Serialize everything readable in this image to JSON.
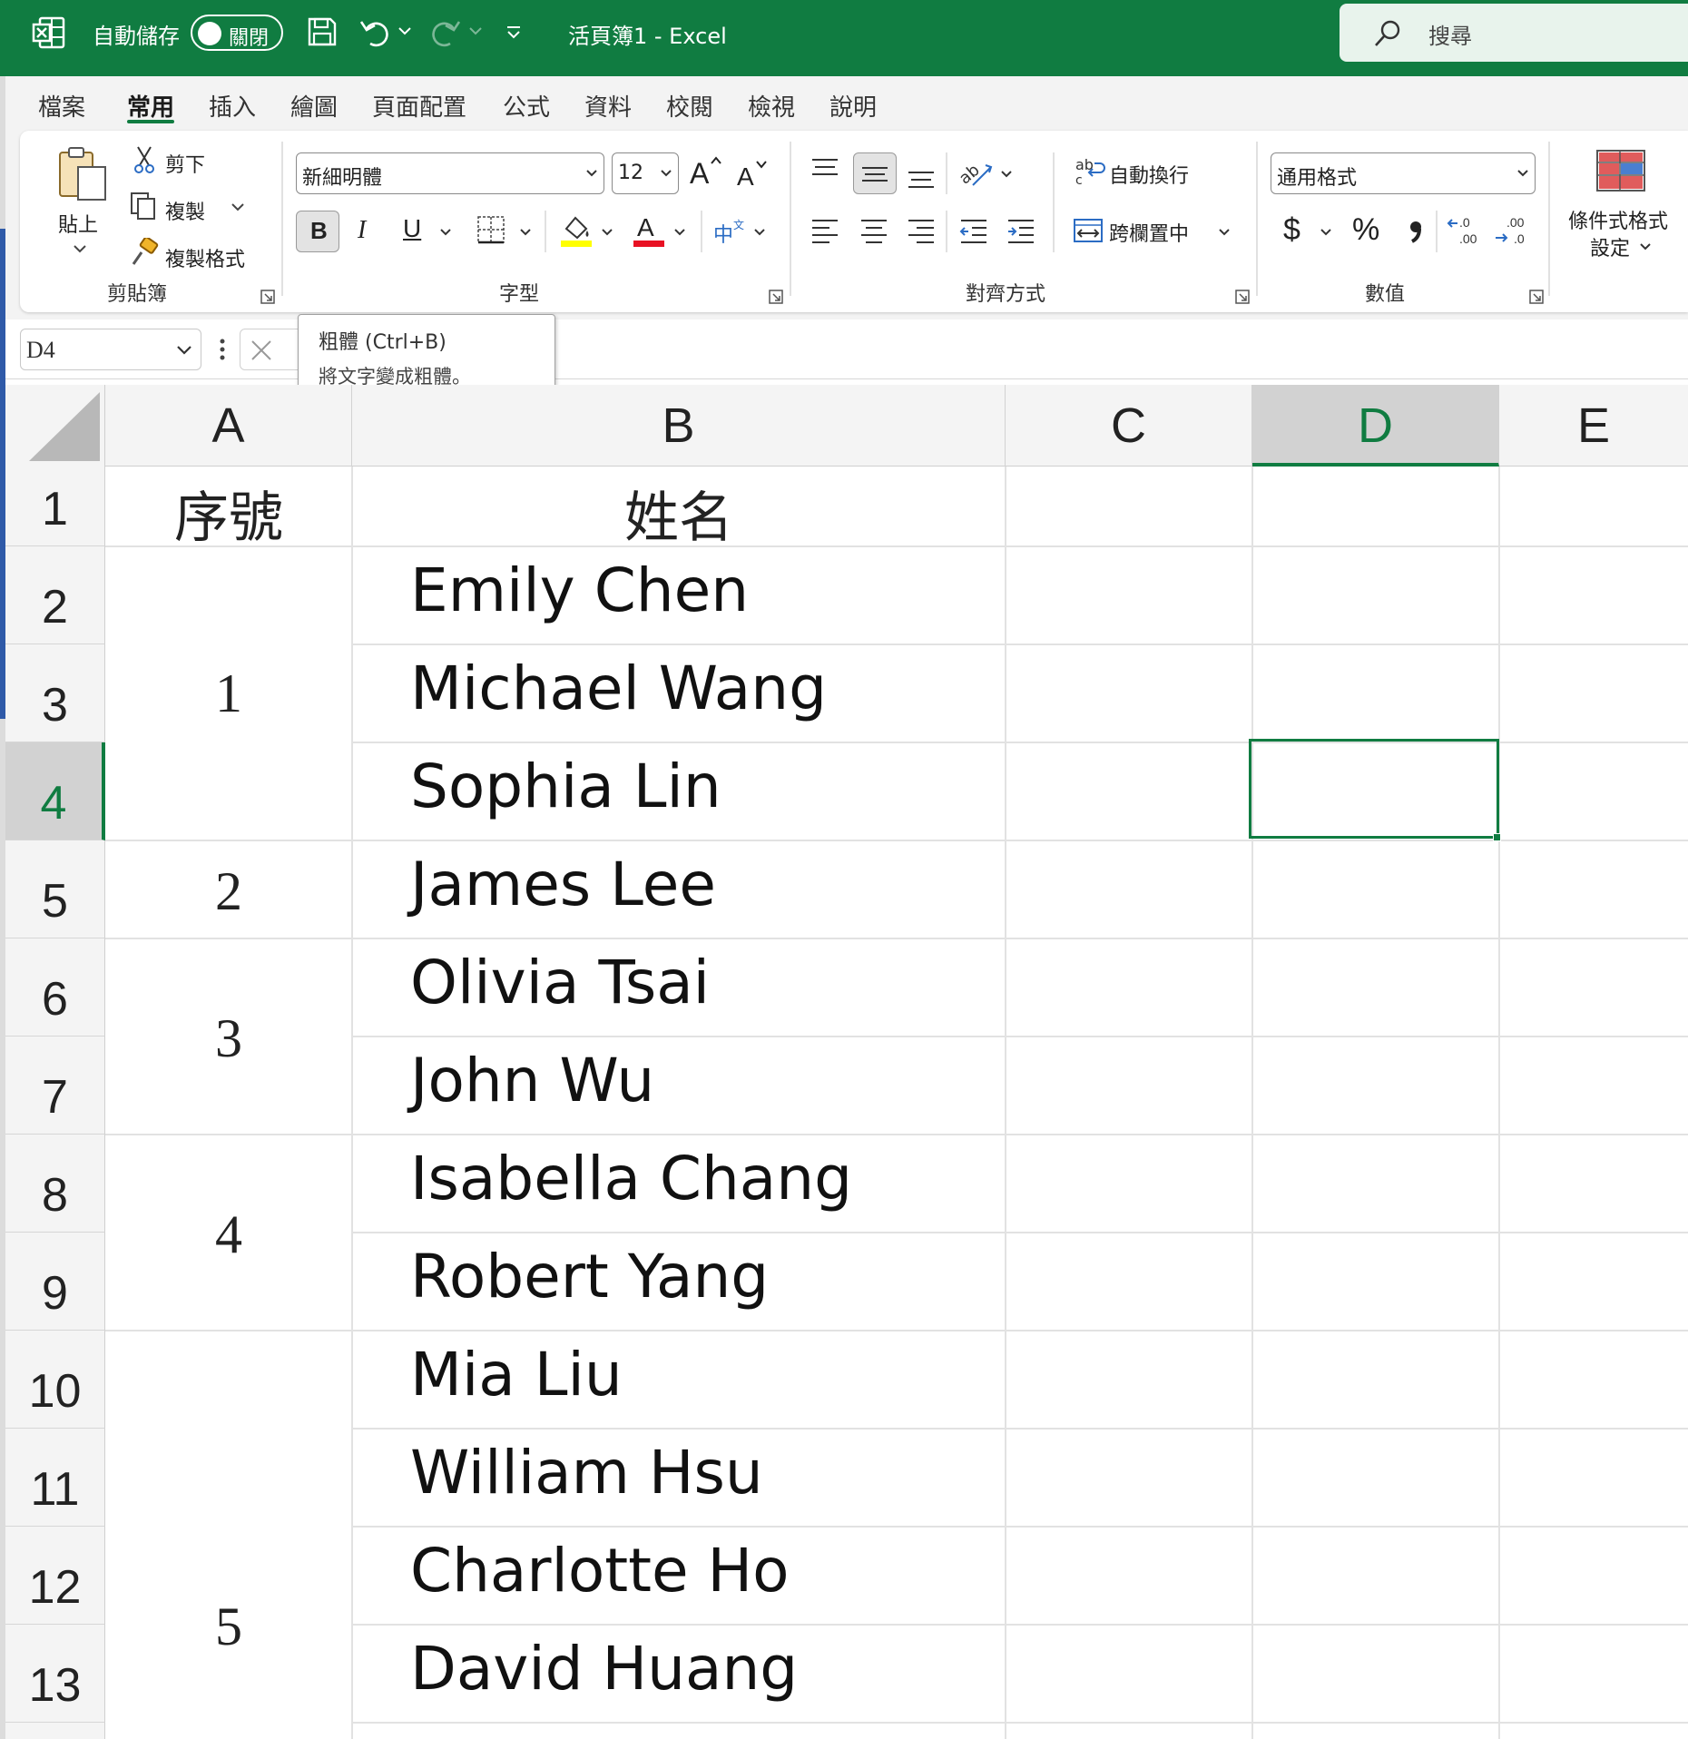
{
  "titlebar": {
    "autosave_label": "自動儲存",
    "autosave_state": "關閉",
    "document_title": "活頁簿1  -  Excel",
    "search_placeholder": "搜尋"
  },
  "menu": {
    "tabs": [
      "檔案",
      "常用",
      "插入",
      "繪圖",
      "頁面配置",
      "公式",
      "資料",
      "校閱",
      "檢視",
      "說明"
    ],
    "active_tab": "常用"
  },
  "ribbon": {
    "clipboard": {
      "paste": "貼上",
      "cut": "剪下",
      "copy": "複製",
      "format_painter": "複製格式",
      "group_label": "剪貼簿"
    },
    "font": {
      "font_name": "新細明體",
      "font_size": "12",
      "group_label": "字型",
      "bold": "B",
      "italic": "I",
      "underline": "U",
      "grow": "A",
      "shrink": "A",
      "font_color": "A",
      "highlight_color": "#ffff00",
      "font_color_swatch": "#e81123"
    },
    "alignment": {
      "wrap_text": "自動換行",
      "merge_center": "跨欄置中",
      "group_label": "對齊方式"
    },
    "number": {
      "format": "通用格式",
      "currency": "$",
      "percent": "%",
      "group_label": "數值"
    },
    "styles": {
      "conditional_formatting_line1": "條件式格式",
      "conditional_formatting_line2": "設定"
    }
  },
  "formula_bar": {
    "name_box": "D4"
  },
  "tooltip": {
    "title": "粗體 (Ctrl+B)",
    "description": "將文字變成粗體。"
  },
  "sheet": {
    "columns": [
      "A",
      "B",
      "C",
      "D",
      "E"
    ],
    "selected_column": "D",
    "rows": [
      "1",
      "2",
      "3",
      "4",
      "5",
      "6",
      "7",
      "8",
      "9",
      "10",
      "11",
      "12",
      "13"
    ],
    "selected_row": "4",
    "header_row": {
      "A": "序號",
      "B": "姓名"
    },
    "serial_numbers": [
      {
        "value": "1",
        "rows": "2-4"
      },
      {
        "value": "2",
        "rows": "5"
      },
      {
        "value": "3",
        "rows": "6-7"
      },
      {
        "value": "4",
        "rows": "8-9"
      },
      {
        "value": "5",
        "rows": "10-13"
      }
    ],
    "names": [
      "Emily Chen",
      "Michael Wang",
      "Sophia Lin",
      "James Lee",
      "Olivia Tsai",
      "John Wu",
      "Isabella Chang",
      "Robert Yang",
      "Mia Liu",
      "William Hsu",
      "Charlotte Ho",
      "David Huang"
    ],
    "active_cell": "D4",
    "accent_color": "#107c41"
  }
}
